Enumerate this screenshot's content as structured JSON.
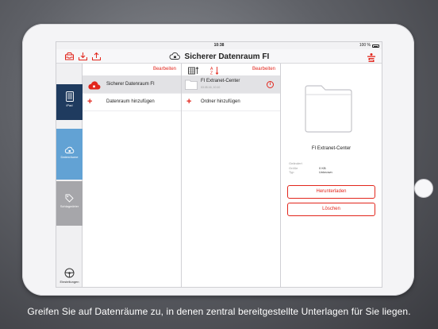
{
  "statusbar": {
    "time": "10:38",
    "battery": "100 %"
  },
  "nav": {
    "title": "Sicherer Datenraum FI"
  },
  "sidebar": {
    "items": [
      {
        "label": "iPad"
      },
      {
        "label": "Datenräume"
      },
      {
        "label": "Schlagwörter"
      },
      {
        "label": "Einstellungen"
      }
    ]
  },
  "col1": {
    "edit": "Bearbeiten",
    "rows": [
      {
        "label": "Sicherer Datenraum FI"
      },
      {
        "label": "Datenraum hinzufügen"
      }
    ]
  },
  "col2": {
    "edit": "Bearbeiten",
    "folder": {
      "name": "FI Extranet-Center",
      "date": "03.05.16, 10:10"
    },
    "add": "Ordner hinzufügen"
  },
  "detail": {
    "name": "FI Extranet-Center",
    "meta": [
      {
        "key": "Geändert",
        "value": ""
      },
      {
        "key": "Größe",
        "value": "0 KB"
      },
      {
        "key": "Typ",
        "value": "Unknown"
      }
    ],
    "download": "Herunterladen",
    "delete": "Löschen"
  },
  "caption": "Greifen Sie auf Datenräume zu, in denen zentral bereitgestellte Unterlagen für Sie liegen.",
  "colors": {
    "accent": "#e2261c",
    "sidebar_active": "#1f3b5f",
    "sidebar_cloud": "#62a2d4"
  }
}
